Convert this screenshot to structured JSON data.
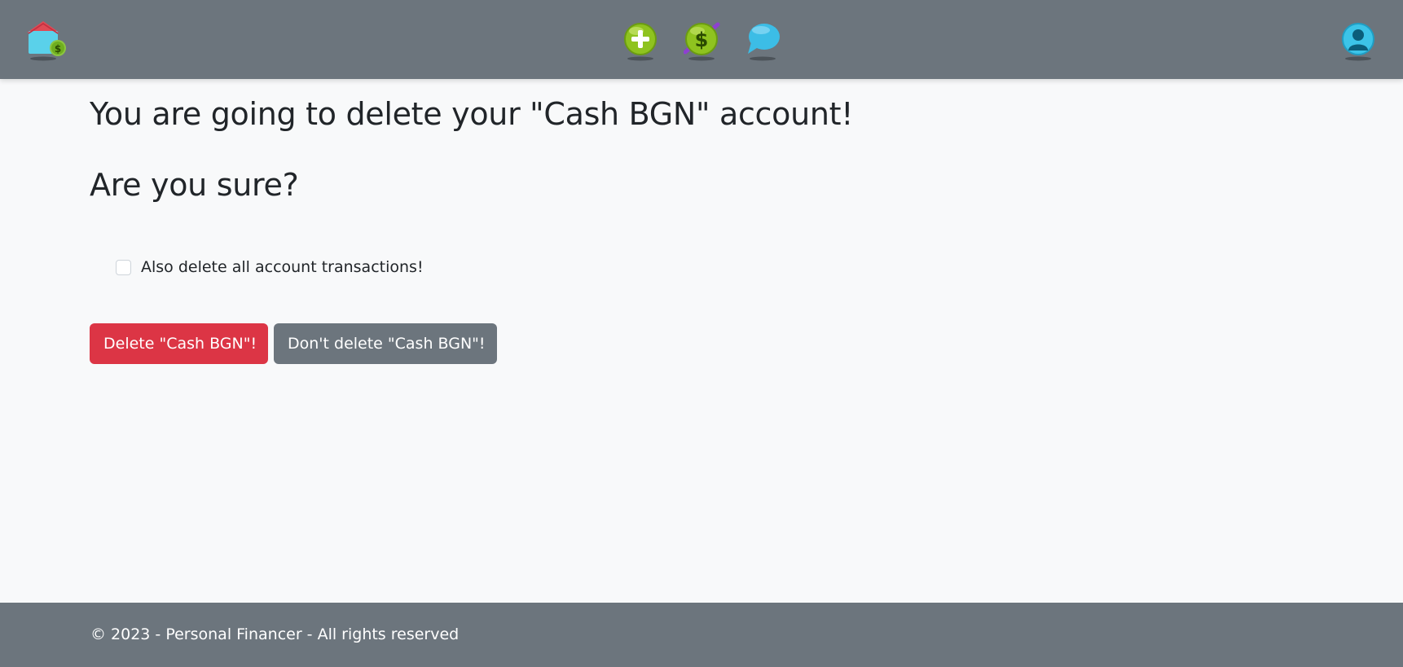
{
  "navbar": {
    "home_icon": "house-dollar-icon",
    "add_icon": "plus-circle-icon",
    "money_icon": "dollar-circle-icon",
    "chat_icon": "speech-bubble-icon",
    "profile_icon": "user-avatar-icon"
  },
  "page": {
    "title": "You are going to delete your \"Cash BGN\" account!",
    "question": "Are you sure?",
    "checkbox_label": "Also delete all account transactions!",
    "checkbox_checked": false,
    "delete_button": "Delete \"Cash BGN\"!",
    "cancel_button": "Don't delete \"Cash BGN\"!"
  },
  "footer": {
    "text": "© 2023 - Personal Financer - All rights reserved"
  },
  "colors": {
    "navbar": "#6c757d",
    "background": "#f8f9fa",
    "danger": "#dc3545",
    "secondary": "#6c757d"
  }
}
